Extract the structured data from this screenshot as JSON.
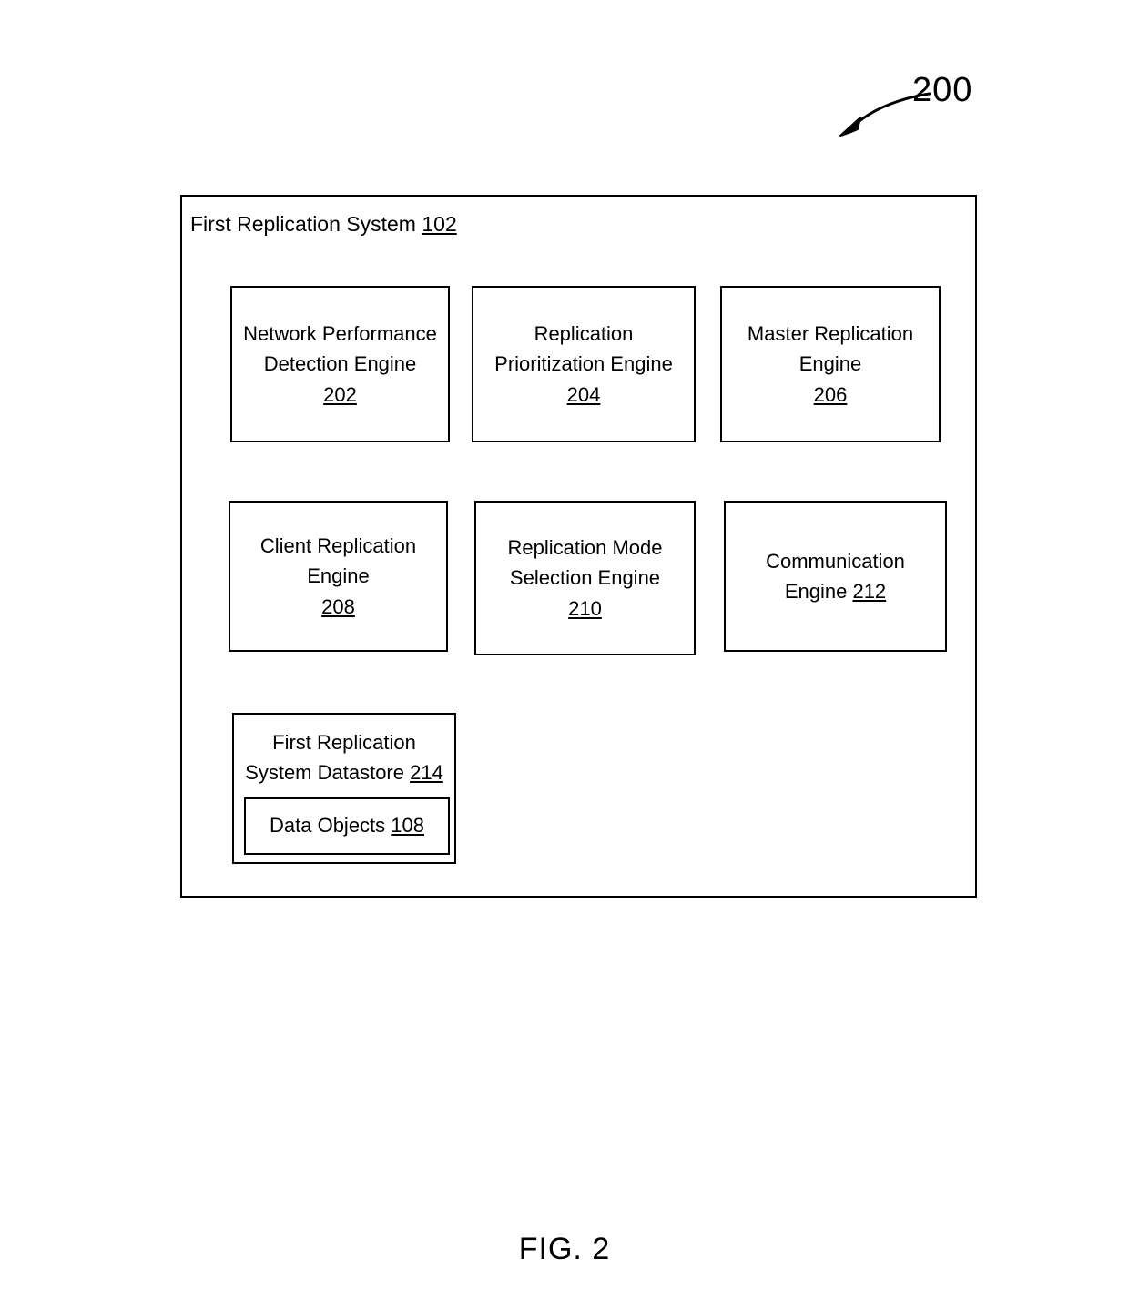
{
  "figure": {
    "reference_number": "200",
    "caption": "FIG. 2",
    "leader_arrow_icon": "curved-arrow-icon"
  },
  "system": {
    "title_text": "First Replication System ",
    "title_ref": "102"
  },
  "engines": [
    {
      "id": "202",
      "name_lines": "Network Performance\nDetection Engine\n",
      "ref": "202",
      "ref_inline": false
    },
    {
      "id": "204",
      "name_lines": "Replication\nPrioritization Engine\n",
      "ref": "204",
      "ref_inline": false
    },
    {
      "id": "206",
      "name_lines": "Master Replication\nEngine\n",
      "ref": "206",
      "ref_inline": false
    },
    {
      "id": "208",
      "name_lines": "Client Replication\nEngine\n",
      "ref": "208",
      "ref_inline": false
    },
    {
      "id": "210",
      "name_lines": "Replication Mode\nSelection Engine\n",
      "ref": "210",
      "ref_inline": false
    },
    {
      "id": "212",
      "name_lines": "Communication\nEngine ",
      "ref": "212",
      "ref_inline": true
    }
  ],
  "datastore": {
    "name_lines": "First Replication\nSystem Datastore ",
    "ref": "214",
    "data_objects": {
      "label": "Data Objects ",
      "ref": "108"
    }
  },
  "colors": {
    "stroke": "#000000",
    "background": "#ffffff",
    "text": "#000000"
  }
}
